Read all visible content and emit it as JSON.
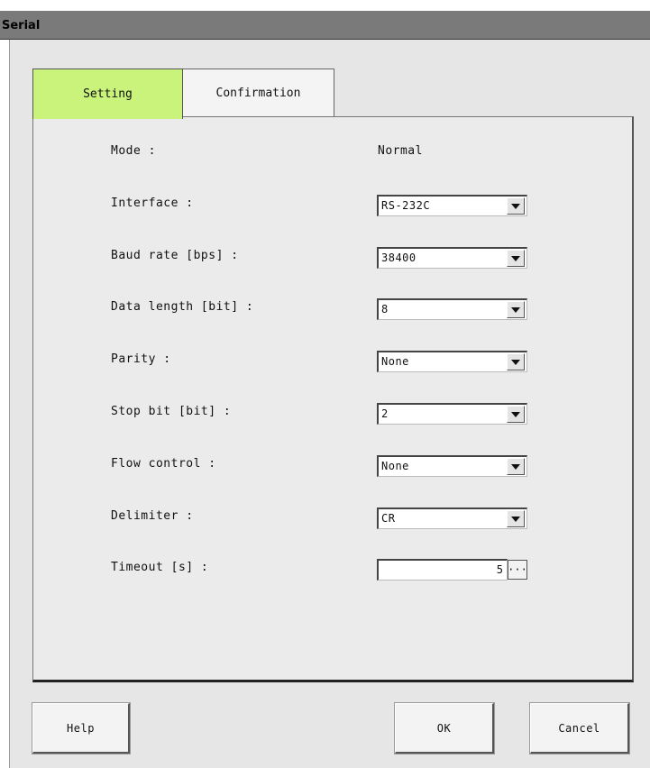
{
  "window": {
    "title": "Serial"
  },
  "tabs": [
    {
      "label": "Setting",
      "active": true
    },
    {
      "label": "Confirmation",
      "active": false
    }
  ],
  "colors": {
    "active_tab": "#c9f37a",
    "title_bar": "#7a7a7a"
  },
  "settings": {
    "mode": {
      "label": "Mode :",
      "value": "Normal"
    },
    "interface": {
      "label": "Interface :",
      "value": "RS-232C"
    },
    "baud_rate": {
      "label": "Baud rate [bps] :",
      "value": "38400"
    },
    "data_length": {
      "label": "Data length [bit] :",
      "value": "8"
    },
    "parity": {
      "label": "Parity :",
      "value": "None"
    },
    "stop_bit": {
      "label": "Stop bit [bit] :",
      "value": "2"
    },
    "flow_control": {
      "label": "Flow control :",
      "value": "None"
    },
    "delimiter": {
      "label": "Delimiter :",
      "value": "CR"
    },
    "timeout": {
      "label": "Timeout [s] :",
      "value": "5",
      "button_label": "···"
    }
  },
  "icons": {
    "dropdown": "triangle-down-icon"
  },
  "buttons": {
    "help": "Help",
    "ok": "OK",
    "cancel": "Cancel"
  }
}
